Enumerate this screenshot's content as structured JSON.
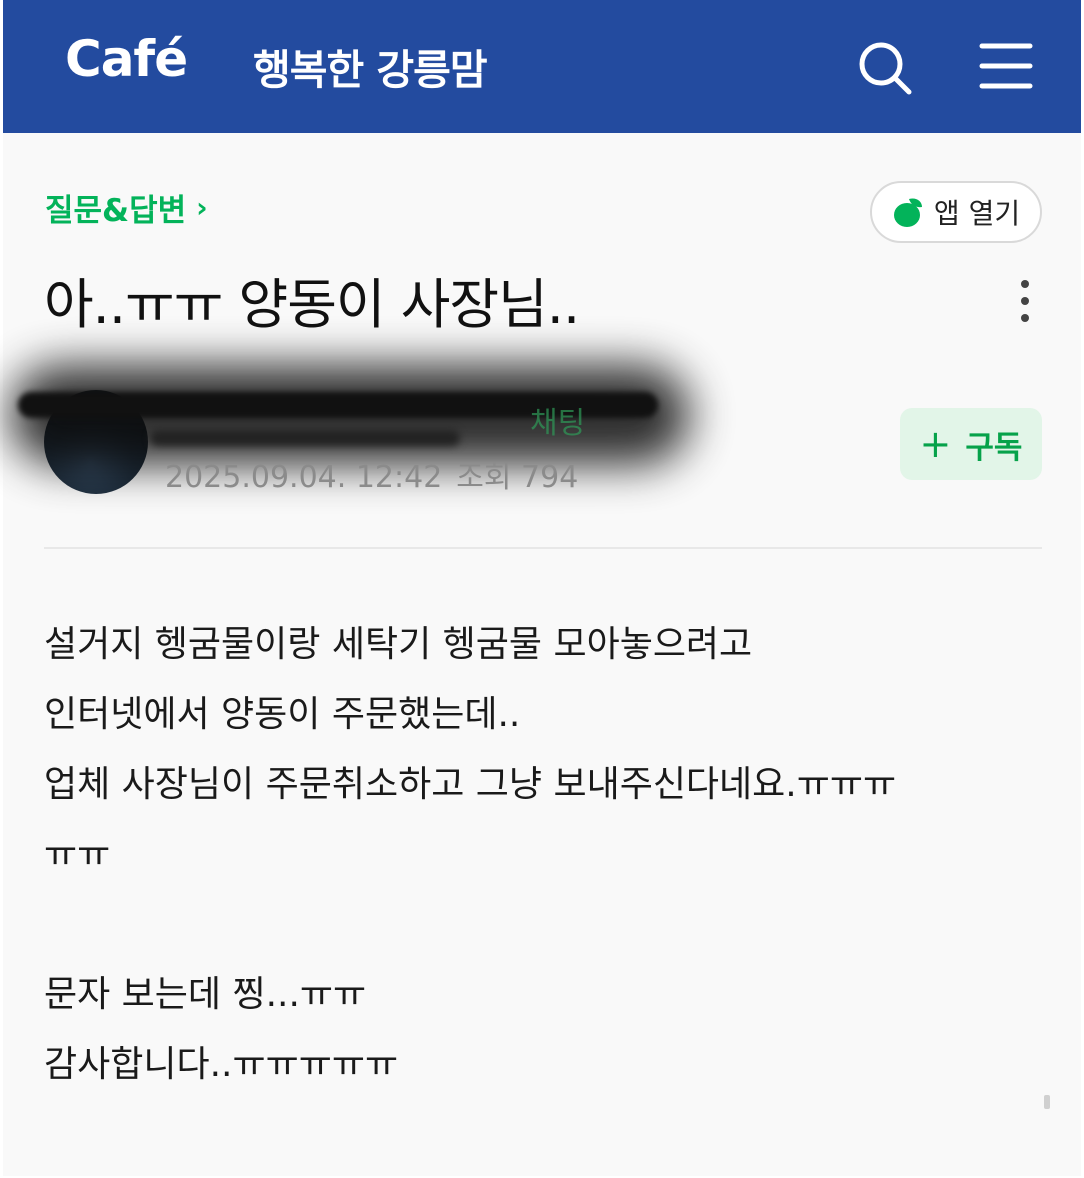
{
  "header": {
    "logo": "Café",
    "cafe_name": "행복한 강릉맘",
    "bg_color": "#234b9f"
  },
  "board": {
    "breadcrumb": "질문&답변",
    "breadcrumb_chevron": "›",
    "app_open_label": "앱 열기"
  },
  "post": {
    "title": "아..ㅠㅠ 양동이 사장님..",
    "author_chat": "채팅",
    "date": "2025.09.04. 12:42",
    "views": "조회 794",
    "subscribe_label": "구독",
    "subscribe_plus": "+",
    "body_lines": [
      "설거지 헹굼물이랑 세탁기 헹굼물 모아놓으려고",
      "인터넷에서 양동이 주문했는데..",
      "업체 사장님이 주문취소하고 그냥 보내주신다네요.ㅠㅠㅠ",
      "ㅠㅠ",
      "",
      "문자 보는데 찡...ㅠㅠ",
      "감사합니다..ㅠㅠㅠㅠㅠ"
    ]
  },
  "colors": {
    "accent_green": "#03b35a",
    "subscribe_bg": "#e2f5e8"
  }
}
